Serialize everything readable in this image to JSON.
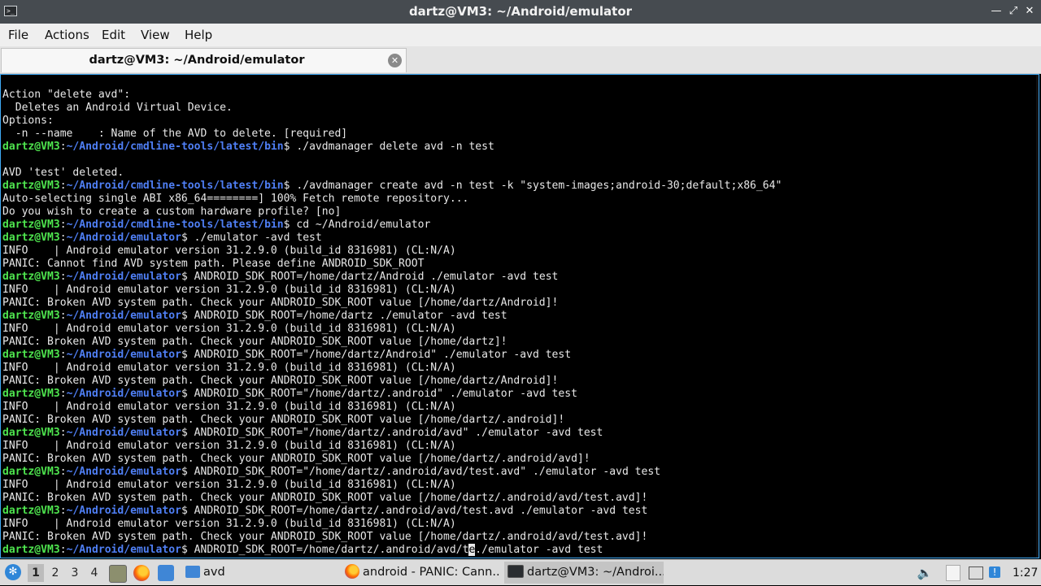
{
  "window": {
    "title": "dartz@VM3: ~/Android/emulator",
    "minimize_icon": "minimize-icon",
    "maximize_icon": "maximize-icon",
    "close_icon": "close-icon"
  },
  "menu": [
    "File",
    "Actions",
    "Edit",
    "View",
    "Help"
  ],
  "tab": {
    "label": "dartz@VM3: ~/Android/emulator",
    "close_icon": "close-circle-icon"
  },
  "terminal": {
    "colors": {
      "user": "#4ee44e",
      "path": "#4f7ff5",
      "text": "#e8e8e8"
    },
    "lines": [
      {
        "text": "Action \"delete avd\":"
      },
      {
        "text": "  Deletes an Android Virtual Device."
      },
      {
        "text": "Options:"
      },
      {
        "text": "  -n --name    : Name of the AVD to delete. [required]"
      },
      {
        "user": "dartz@VM3",
        "path": "~/Android/cmdline-tools/latest/bin",
        "cmd": "./avdmanager delete avd -n test"
      },
      {
        "text": ""
      },
      {
        "text": "AVD 'test' deleted."
      },
      {
        "user": "dartz@VM3",
        "path": "~/Android/cmdline-tools/latest/bin",
        "cmd": "./avdmanager create avd -n test -k \"system-images;android-30;default;x86_64\""
      },
      {
        "text": "Auto-selecting single ABI x86_64========] 100% Fetch remote repository..."
      },
      {
        "text": "Do you wish to create a custom hardware profile? [no]"
      },
      {
        "user": "dartz@VM3",
        "path": "~/Android/cmdline-tools/latest/bin",
        "cmd": "cd ~/Android/emulator"
      },
      {
        "user": "dartz@VM3",
        "path": "~/Android/emulator",
        "cmd": "./emulator -avd test"
      },
      {
        "text": "INFO    | Android emulator version 31.2.9.0 (build_id 8316981) (CL:N/A)"
      },
      {
        "text": "PANIC: Cannot find AVD system path. Please define ANDROID_SDK_ROOT"
      },
      {
        "user": "dartz@VM3",
        "path": "~/Android/emulator",
        "cmd": "ANDROID_SDK_ROOT=/home/dartz/Android ./emulator -avd test"
      },
      {
        "text": "INFO    | Android emulator version 31.2.9.0 (build_id 8316981) (CL:N/A)"
      },
      {
        "text": "PANIC: Broken AVD system path. Check your ANDROID_SDK_ROOT value [/home/dartz/Android]!"
      },
      {
        "user": "dartz@VM3",
        "path": "~/Android/emulator",
        "cmd": "ANDROID_SDK_ROOT=/home/dartz ./emulator -avd test"
      },
      {
        "text": "INFO    | Android emulator version 31.2.9.0 (build_id 8316981) (CL:N/A)"
      },
      {
        "text": "PANIC: Broken AVD system path. Check your ANDROID_SDK_ROOT value [/home/dartz]!"
      },
      {
        "user": "dartz@VM3",
        "path": "~/Android/emulator",
        "cmd": "ANDROID_SDK_ROOT=\"/home/dartz/Android\" ./emulator -avd test"
      },
      {
        "text": "INFO    | Android emulator version 31.2.9.0 (build_id 8316981) (CL:N/A)"
      },
      {
        "text": "PANIC: Broken AVD system path. Check your ANDROID_SDK_ROOT value [/home/dartz/Android]!"
      },
      {
        "user": "dartz@VM3",
        "path": "~/Android/emulator",
        "cmd": "ANDROID_SDK_ROOT=\"/home/dartz/.android\" ./emulator -avd test"
      },
      {
        "text": "INFO    | Android emulator version 31.2.9.0 (build_id 8316981) (CL:N/A)"
      },
      {
        "text": "PANIC: Broken AVD system path. Check your ANDROID_SDK_ROOT value [/home/dartz/.android]!"
      },
      {
        "user": "dartz@VM3",
        "path": "~/Android/emulator",
        "cmd": "ANDROID_SDK_ROOT=\"/home/dartz/.android/avd\" ./emulator -avd test"
      },
      {
        "text": "INFO    | Android emulator version 31.2.9.0 (build_id 8316981) (CL:N/A)"
      },
      {
        "text": "PANIC: Broken AVD system path. Check your ANDROID_SDK_ROOT value [/home/dartz/.android/avd]!"
      },
      {
        "user": "dartz@VM3",
        "path": "~/Android/emulator",
        "cmd": "ANDROID_SDK_ROOT=\"/home/dartz/.android/avd/test.avd\" ./emulator -avd test"
      },
      {
        "text": "INFO    | Android emulator version 31.2.9.0 (build_id 8316981) (CL:N/A)"
      },
      {
        "text": "PANIC: Broken AVD system path. Check your ANDROID_SDK_ROOT value [/home/dartz/.android/avd/test.avd]!"
      },
      {
        "user": "dartz@VM3",
        "path": "~/Android/emulator",
        "cmd": "ANDROID_SDK_ROOT=/home/dartz/.android/avd/test.avd ./emulator -avd test"
      },
      {
        "text": "INFO    | Android emulator version 31.2.9.0 (build_id 8316981) (CL:N/A)"
      },
      {
        "text": "PANIC: Broken AVD system path. Check your ANDROID_SDK_ROOT value [/home/dartz/.android/avd/test.avd]!"
      },
      {
        "user": "dartz@VM3",
        "path": "~/Android/emulator",
        "cmd_before": "ANDROID_SDK_ROOT=/home/dartz/.android/avd/t",
        "cursor": "e",
        "cmd_after": "./emulator -avd test"
      }
    ]
  },
  "taskbar": {
    "start_icon": "start-menu-icon",
    "workspaces": [
      "1",
      "2",
      "3",
      "4"
    ],
    "active_workspace": "1",
    "launchers": [
      "show-desktop-icon",
      "firefox-icon",
      "desktop-icon"
    ],
    "folder_task": "avd",
    "tasks": [
      {
        "label": "android - PANIC: Cann...",
        "icon": "firefox-icon",
        "active": false
      },
      {
        "label": "dartz@VM3: ~/Androi...",
        "icon": "terminal-icon",
        "active": true
      }
    ],
    "tray": [
      "volume-icon",
      "clipboard-icon",
      "network-icon",
      "update-icon"
    ],
    "clock": "1:27"
  }
}
